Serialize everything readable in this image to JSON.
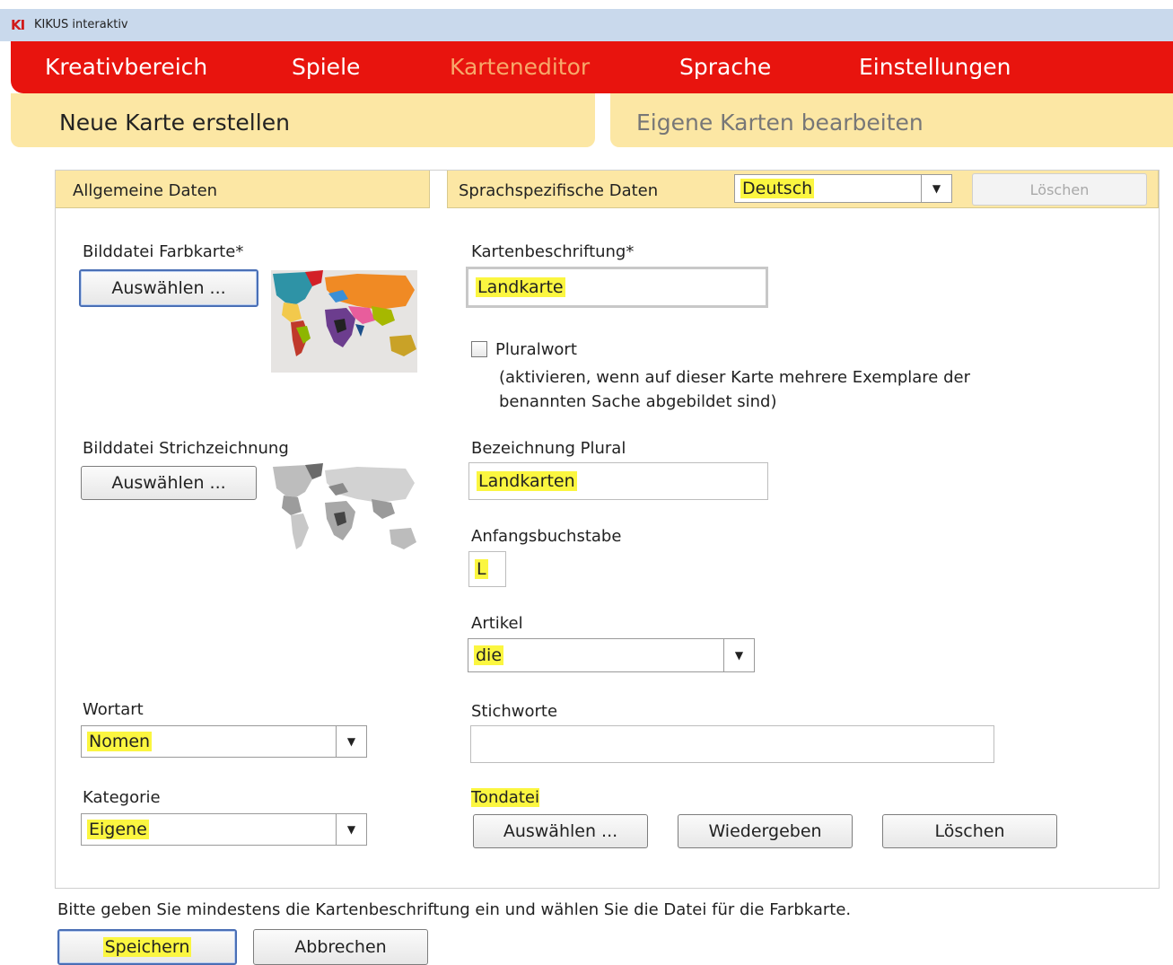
{
  "app": {
    "logo": "KI",
    "title": "KIKUS interaktiv"
  },
  "nav": {
    "items": [
      {
        "label": "Kreativbereich"
      },
      {
        "label": "Spiele"
      },
      {
        "label": "Karteneditor"
      },
      {
        "label": "Sprache"
      },
      {
        "label": "Einstellungen"
      }
    ],
    "active": "Karteneditor"
  },
  "subtabs": {
    "new": "Neue Karte erstellen",
    "edit": "Eigene Karten bearbeiten"
  },
  "panel": {
    "general_tab": "Allgemeine Daten",
    "language_tab": "Sprachspezifische Daten",
    "language_select": "Deutsch",
    "delete_language_button": "Löschen"
  },
  "general": {
    "color_image_label": "Bilddatei Farbkarte*",
    "color_image_button": "Auswählen ...",
    "line_image_label": "Bilddatei Strichzeichnung",
    "line_image_button": "Auswählen ...",
    "word_type_label": "Wortart",
    "word_type_value": "Nomen",
    "category_label": "Kategorie",
    "category_value": "Eigene"
  },
  "language": {
    "caption_label": "Kartenbeschriftung*",
    "caption_value": "Landkarte",
    "plural_checkbox_label": "Pluralwort",
    "plural_checked": false,
    "plural_hint_line1": "(aktivieren, wenn auf dieser Karte mehrere Exemplare der",
    "plural_hint_line2": "benannten Sache abgebildet sind)",
    "plural_label": "Bezeichnung Plural",
    "plural_value": "Landkarten",
    "initial_label": "Anfangsbuchstabe",
    "initial_value": "L",
    "article_label": "Artikel",
    "article_value": "die",
    "keywords_label": "Stichworte",
    "keywords_value": "",
    "sound_label": "Tondatei",
    "sound_select_button": "Auswählen ...",
    "sound_play_button": "Wiedergeben",
    "sound_delete_button": "Löschen"
  },
  "footer": {
    "hint": "Bitte geben Sie mindestens die Kartenbeschriftung ein und wählen Sie die Datei für die Farbkarte.",
    "save_button": "Speichern",
    "cancel_button": "Abbrechen"
  },
  "colors": {
    "nav_red": "#e8140e",
    "nav_active": "#f7a86a",
    "tab_yellow": "#fce7a4",
    "highlight": "#fbf640",
    "titlebar": "#c9d9ec"
  }
}
